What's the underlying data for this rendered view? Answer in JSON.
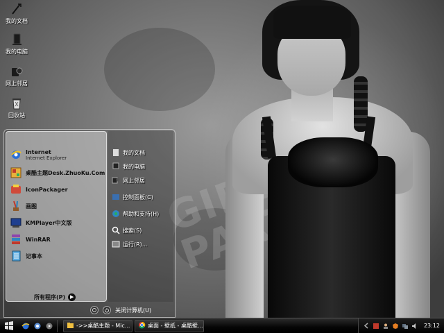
{
  "desktop": {
    "icons": [
      {
        "label": "我的文档",
        "icon": "folder-documents-icon"
      },
      {
        "label": "我的电脑",
        "icon": "computer-icon"
      },
      {
        "label": "网上邻居",
        "icon": "network-icon"
      },
      {
        "label": "回收站",
        "icon": "recycle-bin-icon"
      }
    ],
    "wallpaper_text": "GIRL PARTY"
  },
  "start_menu": {
    "pinned": [
      {
        "title": "Internet",
        "subtitle": "Internet Explorer",
        "icon": "internet-explorer-icon"
      },
      {
        "title": "桌酷主题Desk.ZhuoKu.Com",
        "icon": "zhuoku-theme-icon"
      },
      {
        "title": "IconPackager",
        "icon": "iconpackager-icon"
      },
      {
        "title": "画图",
        "icon": "paint-icon"
      },
      {
        "title": "KMPlayer中文版",
        "icon": "kmplayer-icon"
      },
      {
        "title": "WinRAR",
        "icon": "winrar-icon"
      },
      {
        "title": "记事本",
        "icon": "notepad-icon"
      }
    ],
    "all_programs": "所有程序(P)",
    "places": [
      {
        "label": "我的文档",
        "icon": "documents-icon"
      },
      {
        "label": "我的电脑",
        "icon": "computer-icon"
      },
      {
        "label": "网上邻居",
        "icon": "network-icon"
      },
      {
        "label": "控制面板(C)",
        "icon": "control-panel-icon"
      },
      {
        "label": "帮助和支持(H)",
        "icon": "help-icon"
      },
      {
        "label": "搜索(S)",
        "icon": "search-icon"
      },
      {
        "label": "运行(R)...",
        "icon": "run-icon"
      }
    ],
    "shutdown_label": "关闭计算机(U)"
  },
  "taskbar": {
    "tasks": [
      {
        "label": "->>桌酷主题 - Mic...",
        "icon": "folder-icon"
      },
      {
        "label": "桌面 - 壁纸 - 桌酷壁...",
        "icon": "chrome-icon"
      }
    ],
    "clock": "23:12"
  }
}
